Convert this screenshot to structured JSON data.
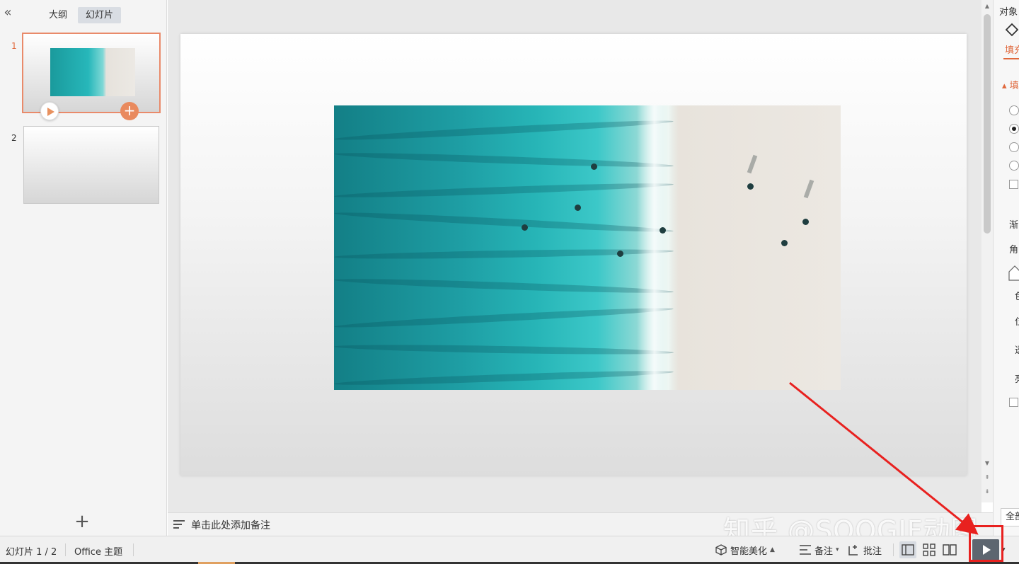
{
  "left_panel": {
    "tabs": [
      {
        "label": "大纲",
        "active": false
      },
      {
        "label": "幻灯片",
        "active": true
      }
    ],
    "slides": [
      {
        "number": "1",
        "active": true
      },
      {
        "number": "2",
        "active": false
      }
    ],
    "add_slide_label": "+"
  },
  "notes": {
    "placeholder": "单击此处添加备注"
  },
  "watermark": "知乎 @SOOGIF动图",
  "right_panel": {
    "title": "对象",
    "fill_tab": "填充",
    "section_label": "填",
    "labels": [
      "渐",
      "角",
      "色",
      "位",
      "透",
      "亮"
    ],
    "all_button": "全部"
  },
  "status_bar": {
    "slide_counter": "幻灯片 1 / 2",
    "theme": "Office 主题",
    "smart_beautify": "智能美化",
    "notes": "备注",
    "comments": "批注"
  },
  "colors": {
    "accent": "#e0683c",
    "highlight": "#e8211f",
    "play_button": "#5d6670"
  }
}
